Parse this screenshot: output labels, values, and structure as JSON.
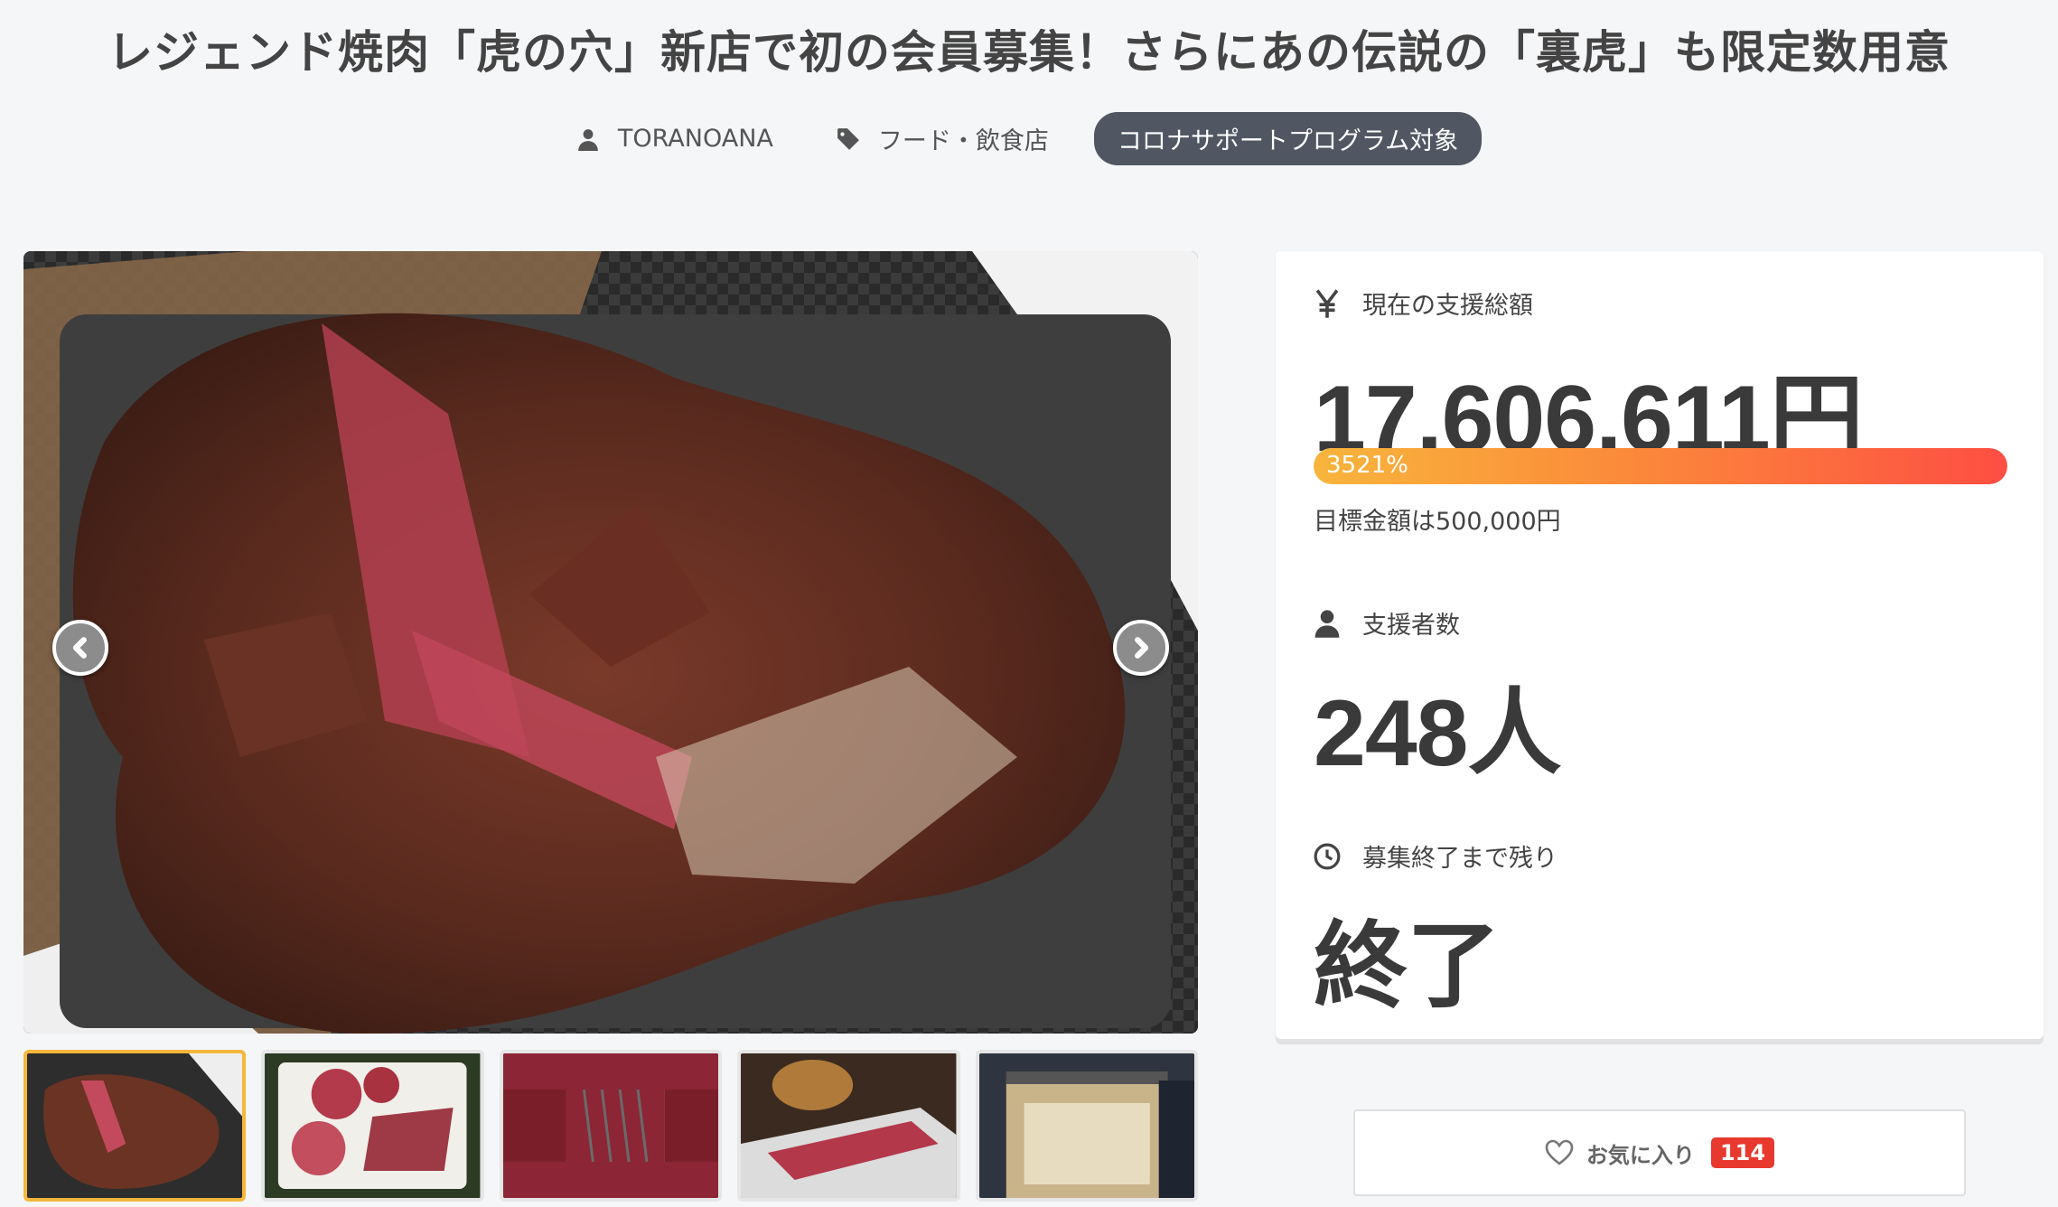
{
  "header": {
    "title": "レジェンド焼肉「虎の穴」新店で初の会員募集！さらにあの伝説の「裏虎」も限定数用意",
    "author": "TORANOANA",
    "category": "フード・飲食店",
    "badge": "コロナサポートプログラム対象",
    "author_icon": "user-icon",
    "category_icon": "tag-icon"
  },
  "gallery": {
    "main_photo_alt": "steak-photo",
    "prev_icon": "chevron-left-icon",
    "next_icon": "chevron-right-icon",
    "thumbnails": [
      "steak-thumb",
      "meat-plate-thumb",
      "raw-meat-grill-thumb",
      "sliced-meat-thumb",
      "storefront-thumb"
    ],
    "active_index": 0
  },
  "stats": {
    "total_label": "現在の支援総額",
    "total_amount": "17,606,611円",
    "progress_percent": "3521%",
    "progress_fill": 1.0,
    "goal_text": "目標金額は500,000円",
    "supporters_label": "支援者数",
    "supporters_value": "248人",
    "remaining_label": "募集終了まで残り",
    "remaining_value": "終了",
    "yen_icon": "yen-icon",
    "person_icon": "person-icon",
    "clock_icon": "clock-icon"
  },
  "favorite": {
    "label": "お気に入り",
    "count": "114",
    "icon": "heart-icon"
  },
  "colors": {
    "badge_bg": "#505763",
    "progress_start": "#f8b53c",
    "progress_end": "#fd4e43",
    "favorite_count_bg": "#e8392f",
    "active_thumb_border": "#f6b73c"
  }
}
